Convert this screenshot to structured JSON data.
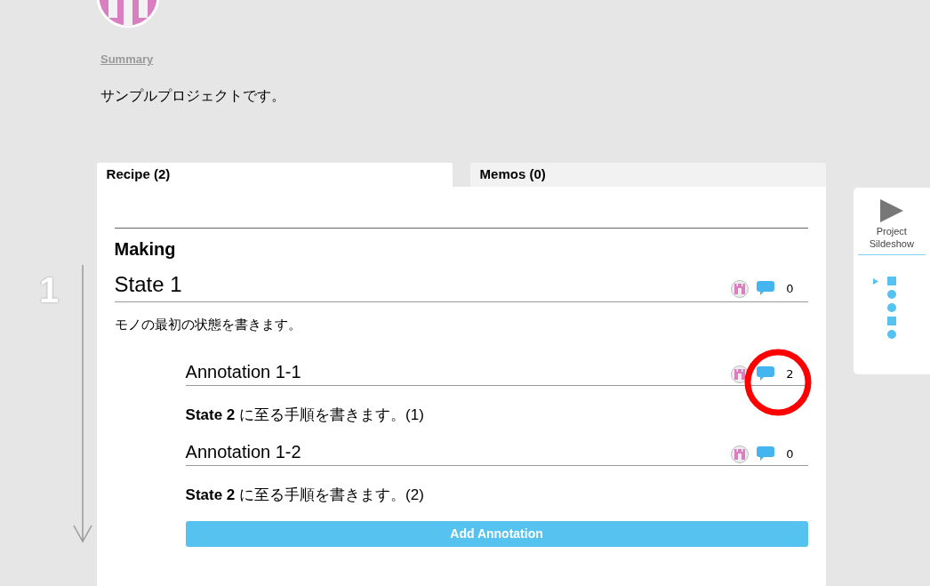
{
  "summary_link": "Summary",
  "summary_text": "サンプルプロジェクトです。",
  "tabs": [
    {
      "label": "Recipe (2)",
      "selected": true
    },
    {
      "label": "Memos (0)",
      "selected": false
    }
  ],
  "section_title": "Making",
  "step_number": "1",
  "state": {
    "title": "State 1",
    "comment_count": "0",
    "description": "モノの最初の状態を書きます。"
  },
  "annotations": [
    {
      "title": "Annotation 1-1",
      "comment_count": "2",
      "text": "**State 2** に至る手順を書きます。(1)",
      "highlighted": true
    },
    {
      "title": "Annotation 1-2",
      "comment_count": "0",
      "text": "**State 2** に至る手順を書きます。(2)",
      "highlighted": false
    }
  ],
  "add_button": "Add Annotation",
  "slideshow": {
    "label_line_1": "Project",
    "label_line_2": "Sildeshow",
    "nav": [
      {
        "kind": "square",
        "selected": true
      },
      {
        "kind": "circle",
        "selected": false
      },
      {
        "kind": "circle",
        "selected": false
      },
      {
        "kind": "square",
        "selected": false
      },
      {
        "kind": "circle",
        "selected": false
      }
    ]
  }
}
